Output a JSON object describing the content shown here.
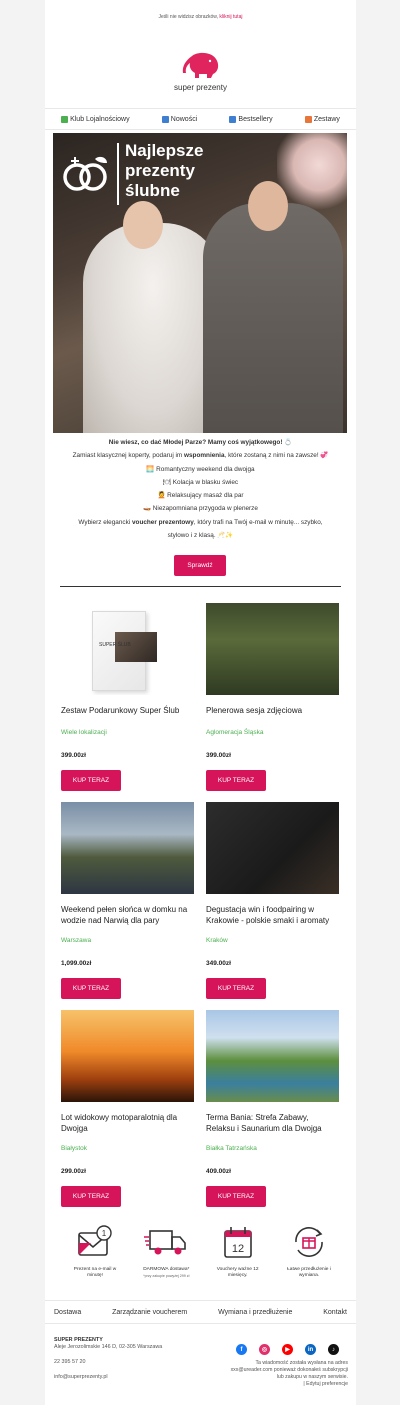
{
  "top_note": {
    "text": "Jeśli nie widzisz obrazków, ",
    "link": "kliknij tutaj"
  },
  "brand": {
    "name": "super prezenty",
    "accent": "#d5145a"
  },
  "nav": {
    "items": [
      {
        "label": "Klub Lojalnościowy",
        "icon": "money-icon"
      },
      {
        "label": "Nowości",
        "icon": "new-icon"
      },
      {
        "label": "Bestsellery",
        "icon": "top-icon"
      },
      {
        "label": "Zestawy",
        "icon": "gift-icon"
      }
    ]
  },
  "hero": {
    "title_lines": [
      "Najlepsze",
      "prezenty",
      "ślubne"
    ]
  },
  "intro": {
    "line1": "Nie wiesz, co dać Młodej Parze? Mamy coś wyjątkowego! 💍",
    "line2_a": "Zamiast klasycznej koperty, podaruj im ",
    "line2_b": "wspomnienia",
    "line2_c": ", które zostaną z nimi na zawsze! 💞",
    "bullets": [
      "🌅 Romantyczny weekend dla dwojga",
      "🍽 Kolacja w blasku świec",
      "💆 Relaksujący masaż dla par",
      "🛶 Niezapomniana przygoda w plenerze"
    ],
    "line_last_a": "Wybierz elegancki ",
    "line_last_b": "voucher prezentowy",
    "line_last_c": ", który trafi na Twój e-mail w minutę... szybko,",
    "line_last_d": "stylowo i z klasą. 🥂✨",
    "cta": "Sprawdź"
  },
  "products": [
    {
      "name": "Zestaw Podarunkowy Super Ślub",
      "location": "Wiele lokalizacji",
      "price": "399.00zł",
      "cta": "KUP TERAZ",
      "box_label": "SUPER ŚLUB"
    },
    {
      "name": "Plenerowa sesja zdjęciowa",
      "location": "Aglomeracja Śląska",
      "price": "399.00zł",
      "cta": "KUP TERAZ"
    },
    {
      "name": "Weekend pełen słońca w domku na wodzie nad Narwią dla pary",
      "location": "Warszawa",
      "price": "1,099.00zł",
      "cta": "KUP TERAZ"
    },
    {
      "name": "Degustacja win i foodpairing w Krakowie - polskie smaki i aromaty",
      "location": "Kraków",
      "price": "349.00zł",
      "cta": "KUP TERAZ"
    },
    {
      "name": "Lot widokowy motoparalotnią dla Dwojga",
      "location": "Białystok",
      "price": "299.00zł",
      "cta": "KUP TERAZ"
    },
    {
      "name": "Terma Bania: Strefa Zabawy, Relaksu i Saunarium dla Dwojga",
      "location": "Białka Tatrzańska",
      "price": "409.00zł",
      "cta": "KUP TERAZ"
    }
  ],
  "features": [
    {
      "text": "Prezent na e-mail w minutę!",
      "icon": "email-icon",
      "badge": "1"
    },
    {
      "text": "DARMOWA dostawa*",
      "small": "*przy zakupie powyżej 299 zł",
      "icon": "delivery-truck-icon"
    },
    {
      "text": "Vouchery ważne 12 miesięcy.",
      "icon": "calendar-icon",
      "badge": "12"
    },
    {
      "text": "Łatwe przedłużenie i wymiana.",
      "icon": "gift-exchange-icon"
    }
  ],
  "footer_nav": [
    "Dostawa",
    "Zarządzanie voucherem",
    "Wymiana i przedłużenie",
    "Kontakt"
  ],
  "company": {
    "name": "SUPER PREZENTY",
    "address": "Aleje Jerozolimskie 146 D, 02-305 Warszawa",
    "phone": "22 395 57 20",
    "email": "info@superprezenty.pl"
  },
  "socials": [
    {
      "name": "facebook-icon",
      "glyph": "f",
      "color": "#1877f2"
    },
    {
      "name": "instagram-icon",
      "glyph": "◎",
      "color": "#e1306c"
    },
    {
      "name": "youtube-icon",
      "glyph": "▶",
      "color": "#ff0000"
    },
    {
      "name": "linkedin-icon",
      "glyph": "in",
      "color": "#0a66c2"
    },
    {
      "name": "tiktok-icon",
      "glyph": "♪",
      "color": "#111111"
    }
  ],
  "legal": {
    "line1": "Ta wiadomość została wysłana na adres",
    "line2": "xxx@ureader.com ponieważ dokonałeś subskrypcji",
    "line3": "lub zakupu w naszym serwisie.",
    "line4": "| Edytuj preferencje"
  }
}
